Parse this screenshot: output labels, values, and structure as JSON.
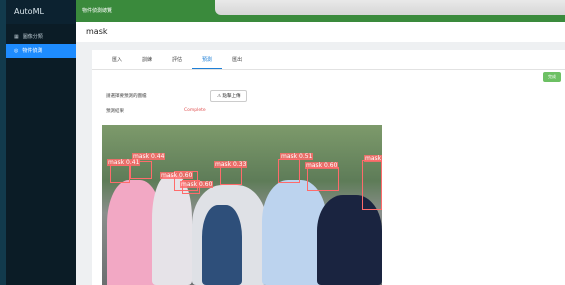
{
  "sidebar": {
    "brand": "AutoML",
    "items": [
      {
        "label": "圖像分類",
        "icon": "grid-icon",
        "active": false
      },
      {
        "label": "物件偵測",
        "icon": "target-icon",
        "active": true
      }
    ]
  },
  "topbar": {
    "title": "物件偵測總覽"
  },
  "page": {
    "title": "mask"
  },
  "tabs": [
    {
      "label": "匯入",
      "active": false
    },
    {
      "label": "訓練",
      "active": false
    },
    {
      "label": "評估",
      "active": false
    },
    {
      "label": "預測",
      "active": true
    },
    {
      "label": "匯出",
      "active": false
    }
  ],
  "ok_button": "完成",
  "form": {
    "upload_label": "請選擇要預測的圖檔",
    "upload_button": "點擊上傳",
    "result_label": "預測結果",
    "result_status": "Complete"
  },
  "colors": {
    "accent": "#1e8cff",
    "topbar": "#3a8a3c",
    "status": "#e05050",
    "box": "#ff6b6b"
  },
  "detections": [
    {
      "label": "mask 0.44"
    },
    {
      "label": "mask 0.41"
    },
    {
      "label": "mask 0.60"
    },
    {
      "label": "mask 0.33"
    },
    {
      "label": "mask 0.51"
    },
    {
      "label": "mask 0.60"
    },
    {
      "label": "mask 0.60"
    },
    {
      "label": "mask"
    }
  ]
}
